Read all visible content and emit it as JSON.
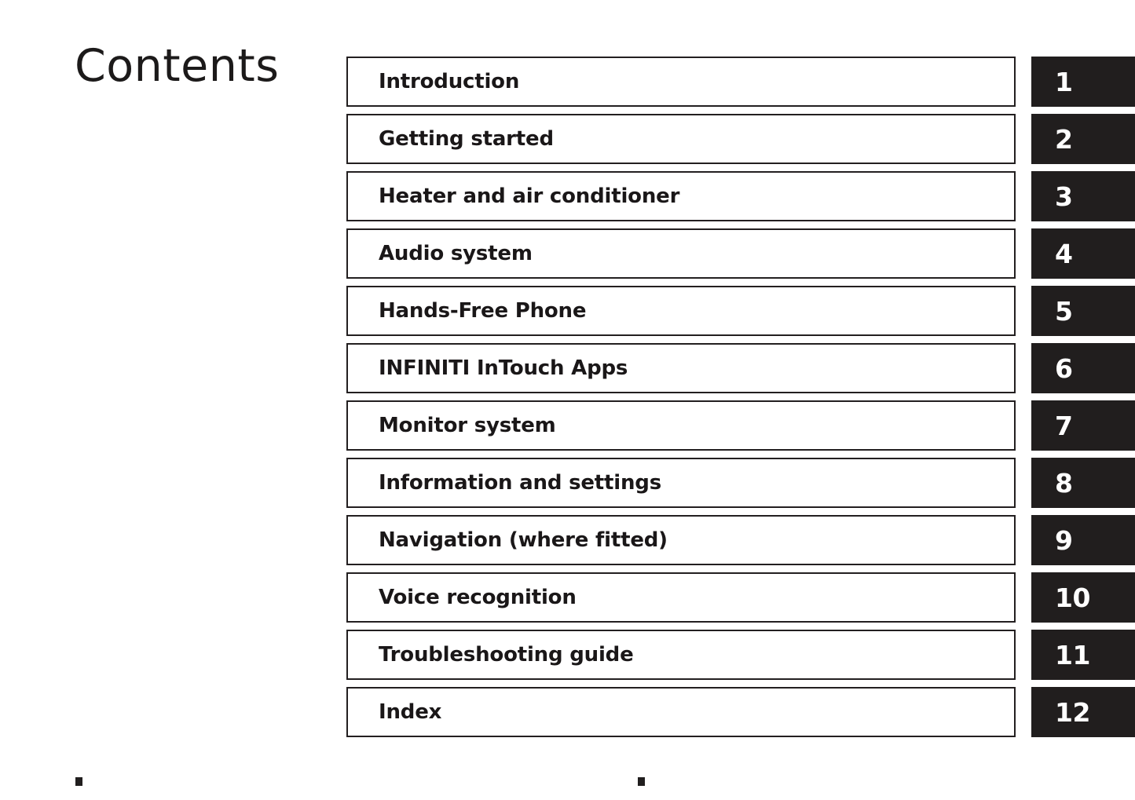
{
  "page": {
    "title": "Contents",
    "background_color": "#ffffff",
    "tab_color": "#211e1e",
    "text_color": "#1a1718"
  },
  "contents": {
    "rows": [
      {
        "label": "Introduction",
        "number": "1"
      },
      {
        "label": "Getting started",
        "number": "2"
      },
      {
        "label": "Heater and air conditioner",
        "number": "3"
      },
      {
        "label": "Audio system",
        "number": "4"
      },
      {
        "label": "Hands-Free Phone",
        "number": "5"
      },
      {
        "label": "INFINITI InTouch Apps",
        "number": "6"
      },
      {
        "label": "Monitor system",
        "number": "7"
      },
      {
        "label": "Information and settings",
        "number": "8"
      },
      {
        "label": "Navigation (where fitted)",
        "number": "9"
      },
      {
        "label": "Voice recognition",
        "number": "10"
      },
      {
        "label": "Troubleshooting guide",
        "number": "11"
      },
      {
        "label": "Index",
        "number": "12"
      }
    ]
  },
  "marks": {
    "left": "registration-mark",
    "right": "registration-mark"
  }
}
